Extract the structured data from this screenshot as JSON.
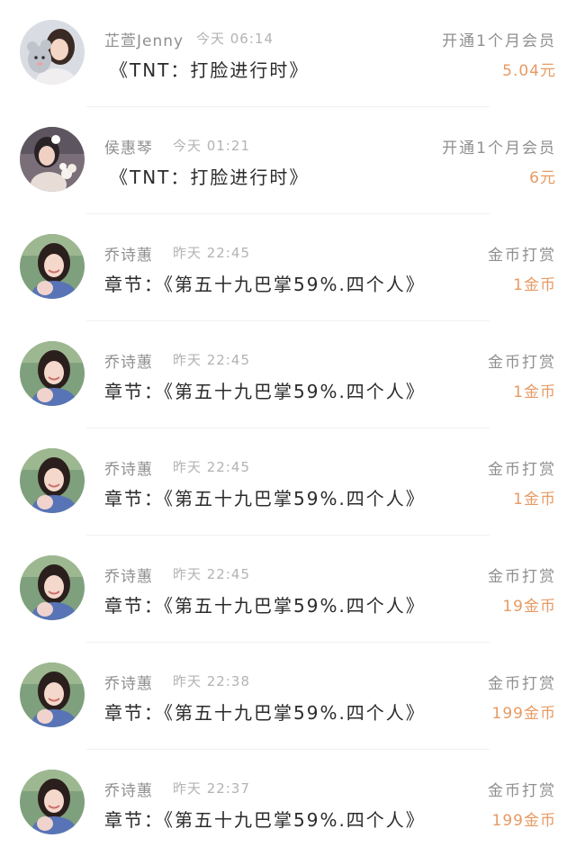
{
  "records": [
    {
      "name": "芷萱Jenny",
      "time": "今天 06:14",
      "type": "开通1个月会员",
      "content": "《TNT：打脸进行时》",
      "amount": "5.04元",
      "avatar": "avatar-girl-with-plush"
    },
    {
      "name": "侯惠琴",
      "time": "今天 01:21",
      "type": "开通1个月会员",
      "content": "《TNT：打脸进行时》",
      "amount": "6元",
      "avatar": "avatar-girl-with-flowers"
    },
    {
      "name": "乔诗蕙",
      "time": "昨天 22:45",
      "type": "金币打赏",
      "content": "章节：《第五十九巴掌59%.四个人》",
      "amount": "1金币",
      "avatar": "avatar-girl-smiling"
    },
    {
      "name": "乔诗蕙",
      "time": "昨天 22:45",
      "type": "金币打赏",
      "content": "章节：《第五十九巴掌59%.四个人》",
      "amount": "1金币",
      "avatar": "avatar-girl-smiling"
    },
    {
      "name": "乔诗蕙",
      "time": "昨天 22:45",
      "type": "金币打赏",
      "content": "章节：《第五十九巴掌59%.四个人》",
      "amount": "1金币",
      "avatar": "avatar-girl-smiling"
    },
    {
      "name": "乔诗蕙",
      "time": "昨天 22:45",
      "type": "金币打赏",
      "content": "章节：《第五十九巴掌59%.四个人》",
      "amount": "19金币",
      "avatar": "avatar-girl-smiling"
    },
    {
      "name": "乔诗蕙",
      "time": "昨天 22:38",
      "type": "金币打赏",
      "content": "章节：《第五十九巴掌59%.四个人》",
      "amount": "199金币",
      "avatar": "avatar-girl-smiling"
    },
    {
      "name": "乔诗蕙",
      "time": "昨天 22:37",
      "type": "金币打赏",
      "content": "章节：《第五十九巴掌59%.四个人》",
      "amount": "199金币",
      "avatar": "avatar-girl-smiling"
    }
  ],
  "colors": {
    "amount": "#e79a63",
    "primary_text": "#2b2b2b",
    "secondary_text": "#8f8f8f",
    "time_text": "#b3b3b3"
  }
}
